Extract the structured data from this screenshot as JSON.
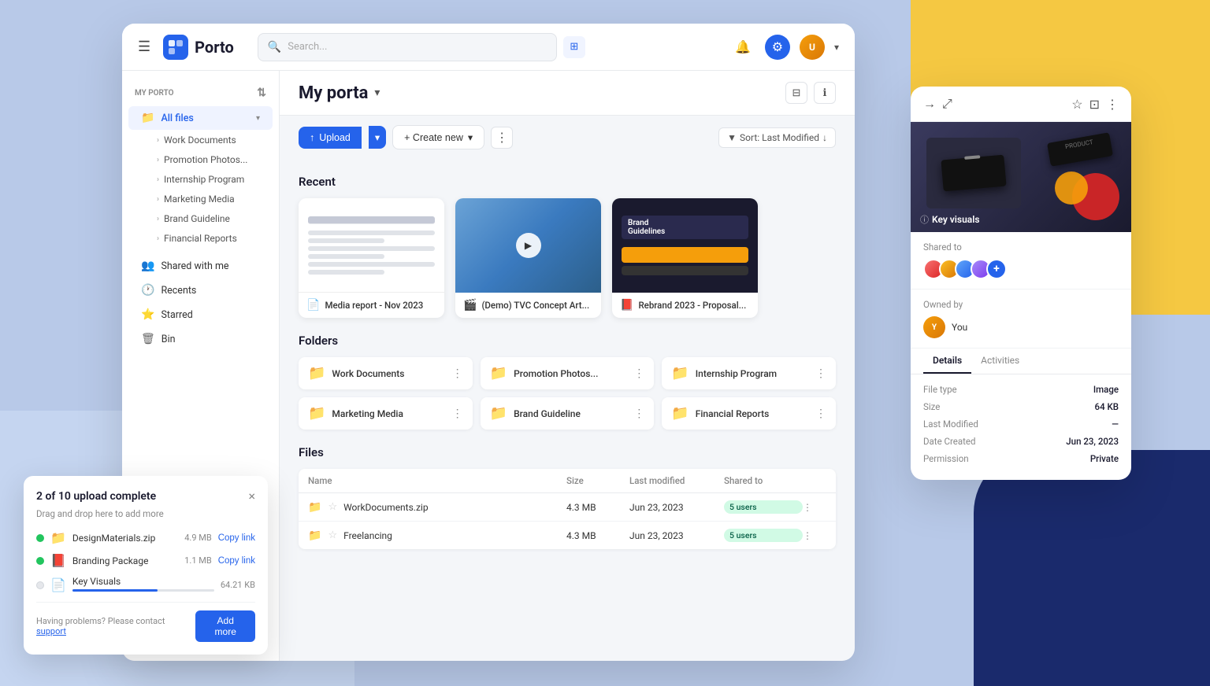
{
  "app": {
    "title": "Porto",
    "logo_icon": "P"
  },
  "background": {
    "colors": {
      "main": "#b8c9e8",
      "yellow": "#f5c842",
      "dark_blue": "#1a2a6c"
    }
  },
  "header": {
    "search_placeholder": "Search...",
    "bell_icon": "🔔",
    "settings_icon": "⚙",
    "avatar_initials": "U"
  },
  "sidebar": {
    "section_label": "MY PORTO",
    "all_files": "All files",
    "items": [
      {
        "label": "Work Documents",
        "icon": "📁"
      },
      {
        "label": "Promotion Photos...",
        "icon": "📁"
      },
      {
        "label": "Internship Program",
        "icon": "📁"
      },
      {
        "label": "Marketing Media",
        "icon": "📁"
      },
      {
        "label": "Brand Guideline",
        "icon": "📁"
      },
      {
        "label": "Financial Reports",
        "icon": "📁"
      }
    ],
    "nav_items": [
      {
        "label": "Shared with me",
        "icon": "👥"
      },
      {
        "label": "Recents",
        "icon": "🕐"
      },
      {
        "label": "Starred",
        "icon": "⭐"
      },
      {
        "label": "Bin",
        "icon": "🗑"
      }
    ]
  },
  "main": {
    "page_title": "My porta",
    "toolbar": {
      "upload_label": "Upload",
      "create_new_label": "+ Create new",
      "sort_label": "Sort: Last Modified"
    },
    "recent": {
      "title": "Recent",
      "files": [
        {
          "name": "Media report - Nov 2023",
          "icon": "📄",
          "type": "doc"
        },
        {
          "name": "(Demo) TVC Concept Art...",
          "icon": "🎬",
          "type": "video"
        },
        {
          "name": "Rebrand 2023 - Proposal...",
          "icon": "📕",
          "type": "brand"
        }
      ]
    },
    "folders": {
      "title": "Folders",
      "items": [
        {
          "name": "Work Documents"
        },
        {
          "name": "Promotion Photos..."
        },
        {
          "name": "Internship Program"
        },
        {
          "name": "Marketing Media"
        },
        {
          "name": "Brand Guideline"
        },
        {
          "name": "Financial Reports"
        }
      ]
    },
    "files": {
      "title": "Files",
      "columns": [
        "Name",
        "Size",
        "Last modified",
        "Shared to",
        ""
      ],
      "rows": [
        {
          "name": "WorkDocuments.zip",
          "size": "4.3 MB",
          "modified": "Jun 23, 2023",
          "shared": "5 users",
          "icon": "📁"
        },
        {
          "name": "Freelancing",
          "size": "4.3 MB",
          "modified": "Jun 23, 2023",
          "shared": "5 users",
          "icon": "📁"
        }
      ]
    }
  },
  "right_panel": {
    "title": "Key visuals",
    "shared_to_label": "Shared to",
    "owned_by_label": "Owned by",
    "owner": "You",
    "tabs": [
      "Details",
      "Activities"
    ],
    "active_tab": "Details",
    "details": [
      {
        "label": "File type",
        "value": "Image"
      },
      {
        "label": "Size",
        "value": "64 KB"
      },
      {
        "label": "Last Modified",
        "value": "—"
      },
      {
        "label": "Date Created",
        "value": "Jun 23, 2023"
      },
      {
        "label": "Permission",
        "value": "Private"
      }
    ]
  },
  "upload_panel": {
    "title": "2 of 10 upload complete",
    "subtitle": "Drag and drop here to add more",
    "close_icon": "×",
    "files": [
      {
        "name": "DesignMaterials.zip",
        "size": "4.9 MB",
        "status": "done",
        "color": "#22c55e"
      },
      {
        "name": "Branding Package",
        "size": "1.1 MB",
        "status": "done",
        "color": "#22c55e"
      },
      {
        "name": "Key Visuals",
        "size": "64.21 KB",
        "status": "progress",
        "color": "#e5e7eb",
        "progress": 60
      }
    ],
    "help_text": "Having problems? Please contact ",
    "help_link": "support",
    "add_more_label": "Add more"
  }
}
